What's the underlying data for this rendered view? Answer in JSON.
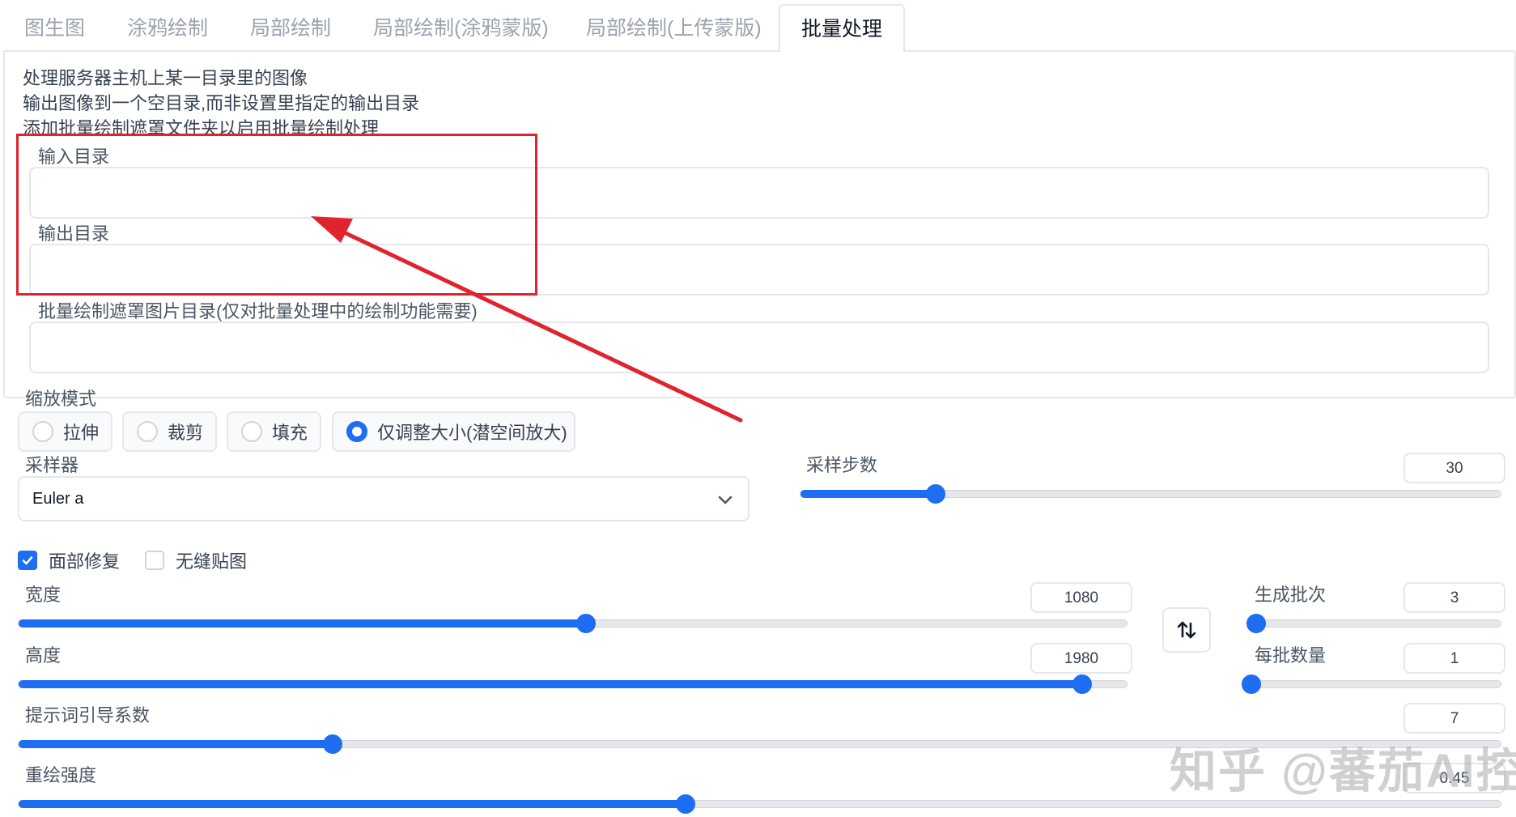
{
  "tabs": [
    {
      "label": "图生图",
      "active": false
    },
    {
      "label": "涂鸦绘制",
      "active": false
    },
    {
      "label": "局部绘制",
      "active": false
    },
    {
      "label": "局部绘制(涂鸦蒙版)",
      "active": false
    },
    {
      "label": "局部绘制(上传蒙版)",
      "active": false
    },
    {
      "label": "批量处理",
      "active": true
    }
  ],
  "description": [
    "处理服务器主机上某一目录里的图像",
    "输出图像到一个空目录,而非设置里指定的输出目录",
    "添加批量绘制遮罩文件夹以启用批量绘制处理"
  ],
  "fields": {
    "input_dir_label": "输入目录",
    "input_dir_value": "",
    "output_dir_label": "输出目录",
    "output_dir_value": "",
    "mask_dir_label": "批量绘制遮罩图片目录(仅对批量处理中的绘制功能需要)",
    "mask_dir_value": ""
  },
  "resize_mode": {
    "label": "缩放模式",
    "options": [
      "拉伸",
      "裁剪",
      "填充",
      "仅调整大小(潜空间放大)"
    ],
    "selected_index": 3
  },
  "sampler": {
    "label": "采样器",
    "value": "Euler a"
  },
  "sampling_steps": {
    "label": "采样步数",
    "value": "30",
    "fraction": 0.1935
  },
  "checkboxes": {
    "face_restore": {
      "label": "面部修复",
      "checked": true
    },
    "tiling": {
      "label": "无缝贴图",
      "checked": false
    }
  },
  "width": {
    "label": "宽度",
    "value": "1080",
    "fraction": 0.512
  },
  "height": {
    "label": "高度",
    "value": "1980",
    "fraction": 0.96
  },
  "batch_count": {
    "label": "生成批次",
    "value": "3",
    "fraction": 0.02
  },
  "batch_size": {
    "label": "每批数量",
    "value": "1",
    "fraction": 0.0
  },
  "cfg_scale": {
    "label": "提示词引导系数",
    "value": "7",
    "fraction": 0.212
  },
  "denoise": {
    "label": "重绘强度",
    "value": "0.45",
    "fraction": 0.45
  },
  "watermark": "知乎 @蕃茄AI控",
  "colors": {
    "accent": "#1d6ef2",
    "annotation": "#e0242e"
  },
  "icons": {
    "swap": "swap-vertical-icon",
    "dropdown": "chevron-down-icon",
    "check": "check-icon"
  }
}
